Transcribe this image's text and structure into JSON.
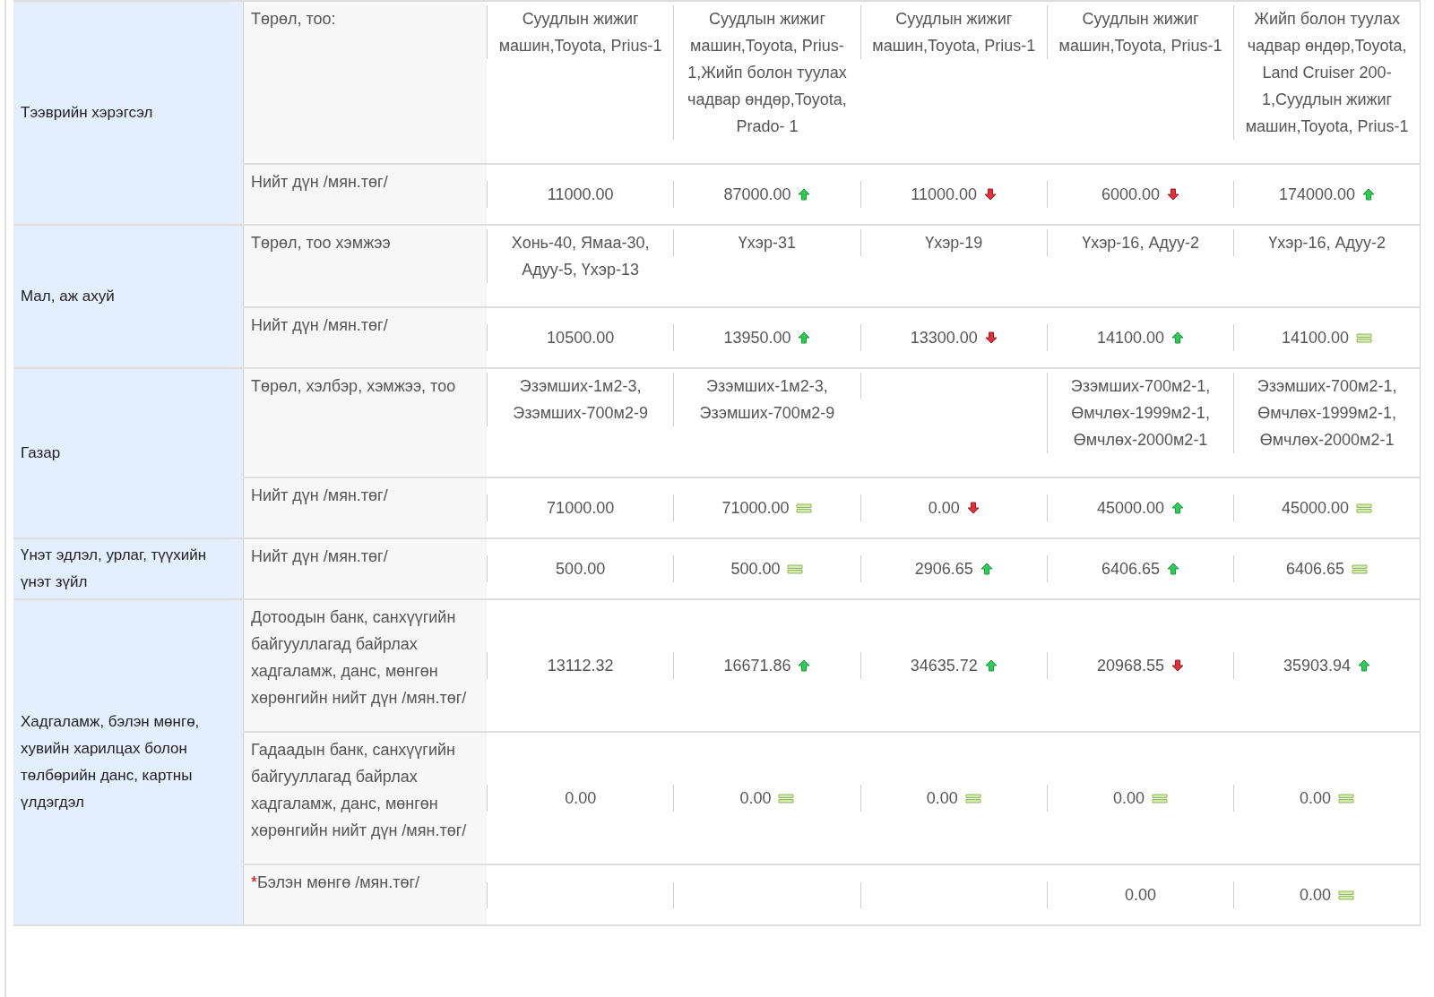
{
  "groups": [
    {
      "label": "Тээврийн хэрэгсэл",
      "rows": [
        {
          "kind": "type",
          "label": "Төрөл, тоо:",
          "cells": [
            {
              "kind": "plain",
              "text": "Суудлын жижиг машин,Toyota, Prius-1"
            },
            {
              "kind": "plain",
              "text": "Суудлын жижиг машин,Toyota, Prius-1,Жийп болон туулах чадвар өндөр,Toyota, Prado- 1"
            },
            {
              "kind": "plain",
              "text": "Суудлын жижиг машин,Toyota, Prius-1"
            },
            {
              "kind": "plain",
              "text": "Суудлын жижиг машин,Toyota, Prius-1"
            },
            {
              "kind": "plain",
              "text": "Жийп болон туулах чадвар өндөр,Toyota, Land Cruiser 200-1,Суудлын жижиг машин,Toyota, Prius-1"
            }
          ]
        },
        {
          "kind": "total",
          "label": "Нийт дүн /мян.төг/",
          "cells": [
            {
              "kind": "plain",
              "text": "11000.00"
            },
            {
              "kind": "up",
              "text": "87000.00"
            },
            {
              "kind": "down",
              "text": "11000.00"
            },
            {
              "kind": "down",
              "text": "6000.00"
            },
            {
              "kind": "up",
              "text": "174000.00"
            }
          ]
        }
      ]
    },
    {
      "label": "Мал, аж ахуй",
      "rows": [
        {
          "kind": "type",
          "label": "Төрөл, тоо хэмжээ",
          "cells": [
            {
              "kind": "plain",
              "text": "Хонь-40, Ямаа-30, Адуу-5, Үхэр-13"
            },
            {
              "kind": "plain",
              "text": "Үхэр-31"
            },
            {
              "kind": "plain",
              "text": "Үхэр-19"
            },
            {
              "kind": "plain",
              "text": "Үхэр-16, Адуу-2"
            },
            {
              "kind": "plain",
              "text": "Үхэр-16, Адуу-2"
            }
          ]
        },
        {
          "kind": "total",
          "label": "Нийт дүн /мян.төг/",
          "cells": [
            {
              "kind": "plain",
              "text": "10500.00"
            },
            {
              "kind": "up",
              "text": "13950.00"
            },
            {
              "kind": "down",
              "text": "13300.00"
            },
            {
              "kind": "up",
              "text": "14100.00"
            },
            {
              "kind": "same",
              "text": "14100.00"
            }
          ]
        }
      ]
    },
    {
      "label": "Газар",
      "rows": [
        {
          "kind": "type",
          "label": "Төрөл, хэлбэр, хэмжээ, тоо",
          "cells": [
            {
              "kind": "plain",
              "text": "Эзэмших-1м2-3, Эзэмших-700м2-9"
            },
            {
              "kind": "plain",
              "text": "Эзэмших-1м2-3, Эзэмших-700м2-9"
            },
            {
              "kind": "plain"
            },
            {
              "kind": "plain",
              "text": "Эзэмших-700м2-1, Өмчлөх-1999м2-1, Өмчлөх-2000м2-1"
            },
            {
              "kind": "plain",
              "text": "Эзэмших-700м2-1, Өмчлөх-1999м2-1, Өмчлөх-2000м2-1"
            }
          ]
        },
        {
          "kind": "total",
          "label": "Нийт дүн /мян.төг/",
          "cells": [
            {
              "kind": "plain",
              "text": "71000.00"
            },
            {
              "kind": "same",
              "text": "71000.00"
            },
            {
              "kind": "down",
              "text": "0.00"
            },
            {
              "kind": "up",
              "text": "45000.00"
            },
            {
              "kind": "same",
              "text": "45000.00"
            }
          ]
        }
      ]
    },
    {
      "label": "Үнэт эдлэл, урлаг, түүхийн үнэт зүйл",
      "rows": [
        {
          "kind": "total",
          "label": "Нийт дүн /мян.төг/",
          "cells": [
            {
              "kind": "plain",
              "text": "500.00"
            },
            {
              "kind": "same",
              "text": "500.00"
            },
            {
              "kind": "up",
              "text": "2906.65"
            },
            {
              "kind": "up",
              "text": "6406.65"
            },
            {
              "kind": "same",
              "text": "6406.65"
            }
          ]
        }
      ]
    },
    {
      "label": "Хадгаламж, бэлэн мөнгө, хувийн харилцах болон төлбөрийн данс, картны үлдэгдэл",
      "rows": [
        {
          "kind": "total",
          "label": "Дотоодын банк, санхүүгийн байгууллагад байрлах хадгаламж, данс, мөнгөн хөрөнгийн нийт дүн /мян.төг/",
          "cells": [
            {
              "kind": "plain",
              "text": "13112.32"
            },
            {
              "kind": "up",
              "text": "16671.86"
            },
            {
              "kind": "up",
              "text": "34635.72"
            },
            {
              "kind": "down",
              "text": "20968.55"
            },
            {
              "kind": "up",
              "text": "35903.94"
            }
          ]
        },
        {
          "kind": "total",
          "label": "Гадаадын банк, санхүүгийн байгууллагад байрлах хадгаламж, данс, мөнгөн хөрөнгийн нийт дүн /мян.төг/",
          "cells": [
            {
              "kind": "plain",
              "text": "0.00"
            },
            {
              "kind": "same",
              "text": "0.00"
            },
            {
              "kind": "same",
              "text": "0.00"
            },
            {
              "kind": "same",
              "text": "0.00"
            },
            {
              "kind": "same",
              "text": "0.00"
            }
          ]
        },
        {
          "kind": "total",
          "required_mark": "*",
          "label": "Бэлэн мөнгө /мян.төг/",
          "cells": [
            {
              "kind": "plain"
            },
            {
              "kind": "plain"
            },
            {
              "kind": "plain"
            },
            {
              "kind": "plain",
              "text": "0.00"
            },
            {
              "kind": "same",
              "text": "0.00"
            }
          ]
        }
      ]
    }
  ]
}
